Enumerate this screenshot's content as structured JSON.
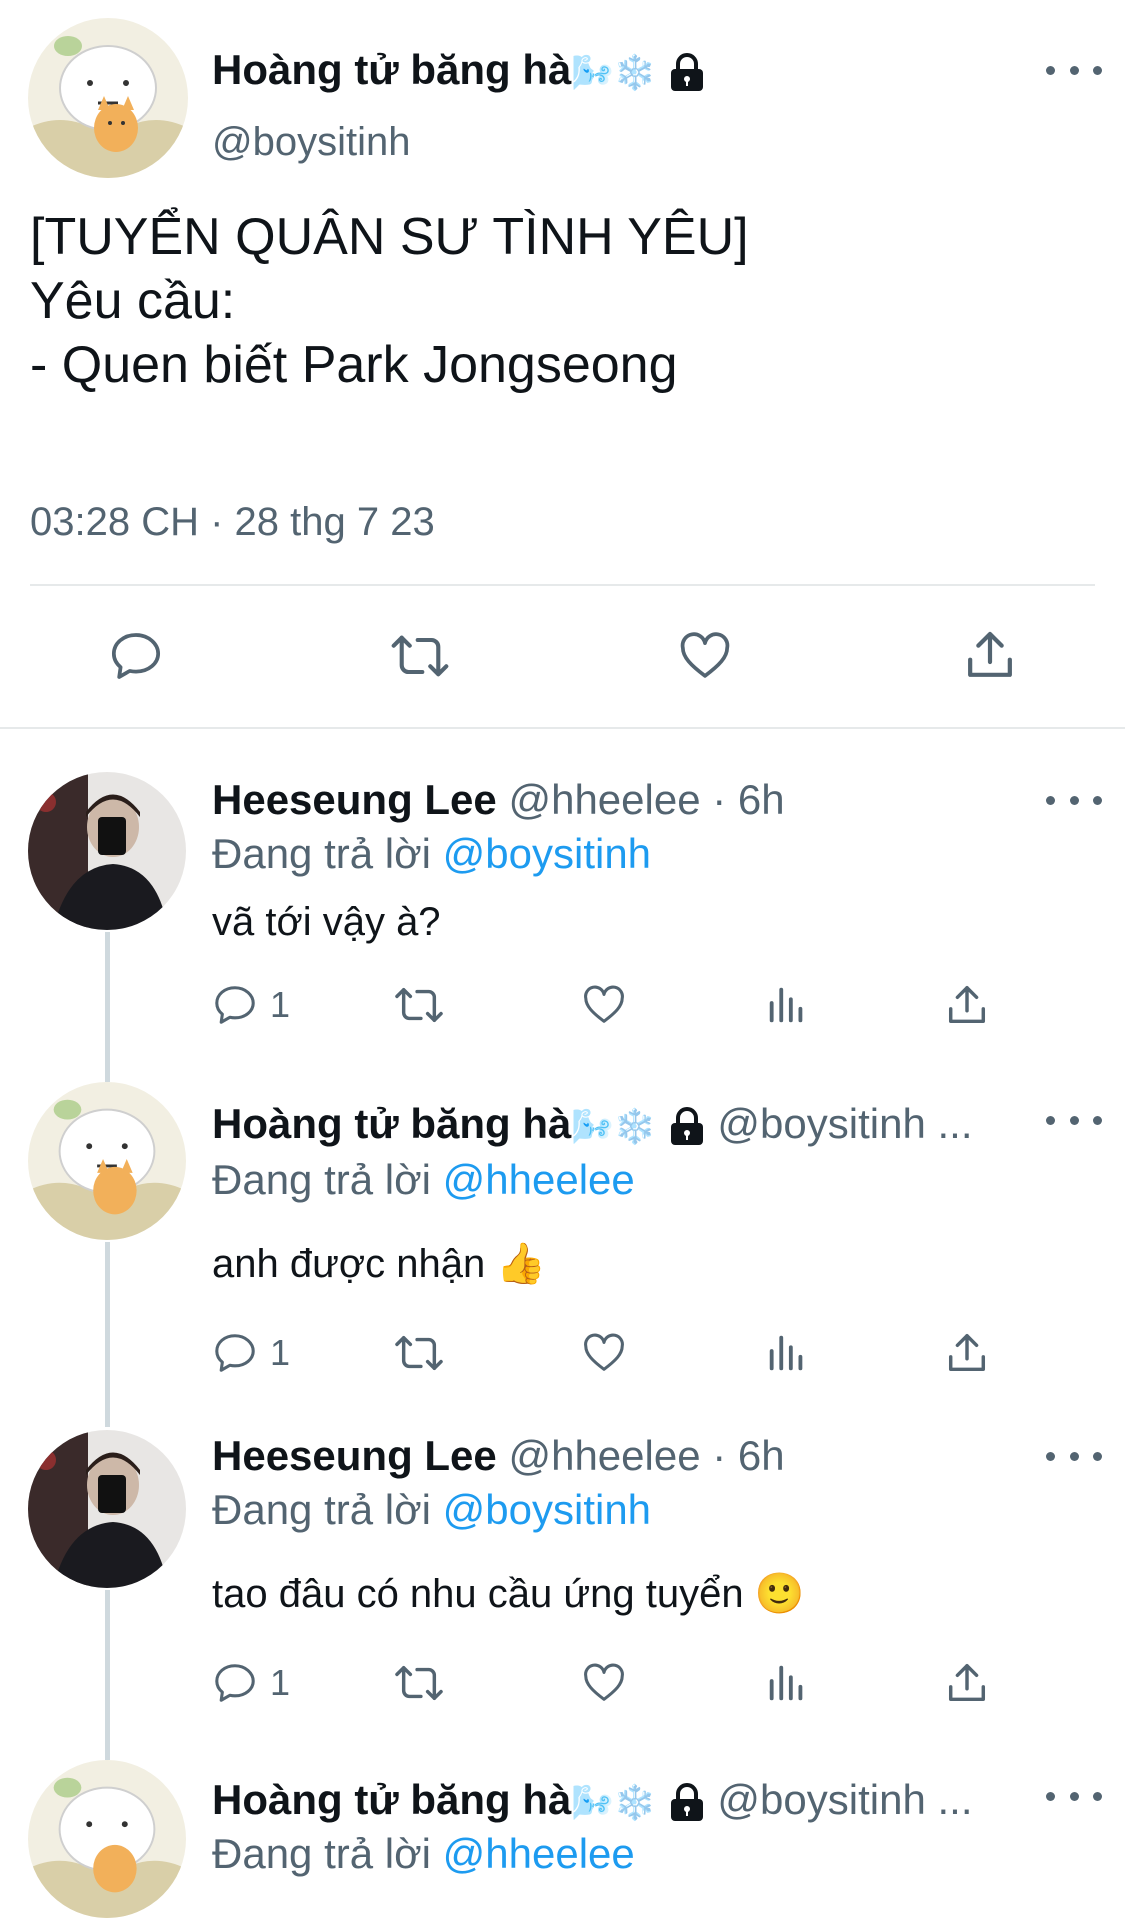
{
  "main_tweet": {
    "display_name": "Hoàng tử băng hà",
    "name_emojis": "🌬️❄️",
    "handle": "@boysitinh",
    "text_lines": [
      "[TUYỂN QUÂN SƯ TÌNH YÊU]",
      "Yêu cầu:",
      "- Quen biết Park Jongseong"
    ],
    "timestamp": "03:28 CH · 28 thg 7 23"
  },
  "replies": [
    {
      "display_name": "Heeseung Lee",
      "handle": "@hheelee",
      "time": "· 6h",
      "replying_prefix": "Đang trả lời",
      "replying_to": "@boysitinh",
      "text": "vã tới vậy à?",
      "reply_count": "1"
    },
    {
      "display_name": "Hoàng tử băng hà",
      "name_emojis": "🌬️❄️",
      "handle": "@boysitinh ...",
      "replying_prefix": "Đang trả lời",
      "replying_to": "@hheelee",
      "text": "anh được nhận 👍",
      "reply_count": "1"
    },
    {
      "display_name": "Heeseung Lee",
      "handle": "@hheelee",
      "time": "· 6h",
      "replying_prefix": "Đang trả lời",
      "replying_to": "@boysitinh",
      "text": "tao đâu có nhu cầu ứng tuyển 🙂",
      "reply_count": "1"
    },
    {
      "display_name": "Hoàng tử băng hà",
      "name_emojis": "🌬️❄️",
      "handle": "@boysitinh ...",
      "replying_prefix": "Đang trả lời",
      "replying_to": "@hheelee"
    }
  ],
  "icons": {
    "reply": "reply-icon",
    "retweet": "retweet-icon",
    "like": "heart-icon",
    "views": "views-icon",
    "share": "share-icon",
    "more": "more-icon",
    "lock": "lock-icon"
  },
  "colors": {
    "accent": "#1d9bf0",
    "secondary_text": "#536471",
    "thread_line": "#cfd9de"
  }
}
